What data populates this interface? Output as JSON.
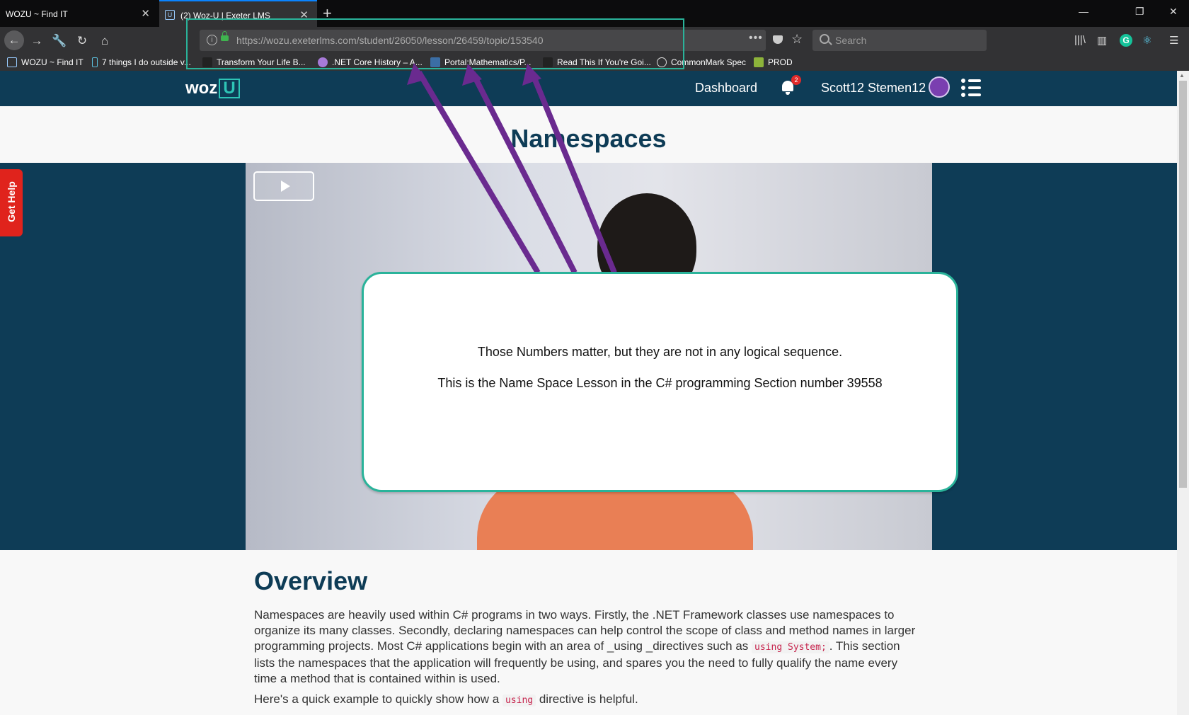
{
  "browser": {
    "tabs": [
      {
        "title": "WOZU ~ Find IT"
      },
      {
        "title": "(2) Woz-U | Exeter LMS"
      }
    ],
    "url": "https://wozu.exeterlms.com/student/26050/lesson/26459/topic/153540",
    "search_placeholder": "Search",
    "bookmarks": [
      {
        "label": "WOZU ~ Find IT"
      },
      {
        "label": "7 things I do outside v..."
      },
      {
        "label": "Transform Your Life B..."
      },
      {
        "label": ".NET Core History – A..."
      },
      {
        "label": "Portal:Mathematics/P..."
      },
      {
        "label": "Read This If You're Goi..."
      },
      {
        "label": "CommonMark Spec"
      },
      {
        "label": "PROD"
      }
    ]
  },
  "site": {
    "logo_text": "woz",
    "logo_box": "U",
    "nav_dashboard": "Dashboard",
    "notification_count": "2",
    "username": "Scott12 Stemen12"
  },
  "lesson": {
    "title": "Namespaces",
    "get_help": "Get Help",
    "overview_heading": "Overview",
    "paragraph1_a": "Namespaces are heavily used within C# programs in two ways. Firstly, the .NET Framework classes use namespaces to organize its many classes. Secondly, declaring namespaces can help control the scope of class and method names in larger programming projects. Most C# applications begin with an area of _using _directives such as ",
    "paragraph1_code": "using System;",
    "paragraph1_b": ". This section lists the namespaces that the application will frequently be using, and spares you the need to fully qualify the name every time a method that is contained within is used.",
    "paragraph2_a": "Here's a quick example to quickly show how a ",
    "paragraph2_code": "using",
    "paragraph2_b": " directive is helpful."
  },
  "annotation": {
    "line1": "Those Numbers matter, but they are not in any logical sequence.",
    "line2": "This is the Name Space Lesson in the C# programming Section number 39558",
    "frame_color": "#2ab39a",
    "arrow_color": "#6a2a8f"
  },
  "colors": {
    "header_bg": "#0e3c56",
    "accent": "#2ec4b6",
    "help_red": "#e0231c"
  }
}
